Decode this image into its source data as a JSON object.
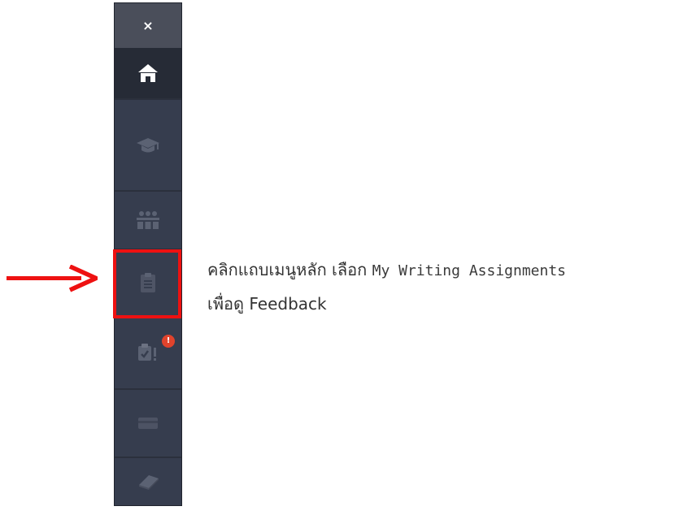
{
  "sidebar": {
    "close_label": "×",
    "items": [
      {
        "icon": "home-icon",
        "active": true
      },
      {
        "icon": "graduation-cap-icon",
        "active": false
      },
      {
        "icon": "classroom-icon",
        "active": false
      },
      {
        "icon": "clipboard-icon",
        "active": false,
        "highlighted": true
      },
      {
        "icon": "assignment-alert-icon",
        "active": false,
        "badge": "!"
      },
      {
        "icon": "card-icon",
        "active": false
      },
      {
        "icon": "book-icon",
        "active": false
      }
    ],
    "colors": {
      "background": "#363d4e",
      "active_background": "#262b36",
      "close_background": "#4a4e5a",
      "icon_inactive": "#5b6273",
      "badge": "#e0432c"
    }
  },
  "annotation": {
    "highlight_color": "#ee1111",
    "arrow_color": "#ee1111",
    "caption_line1_prefix": "คลิกแถบเมนูหลัก เลือก ",
    "caption_menu_name": "My Writing Assignments",
    "caption_line2": "เพื่อดู Feedback"
  }
}
